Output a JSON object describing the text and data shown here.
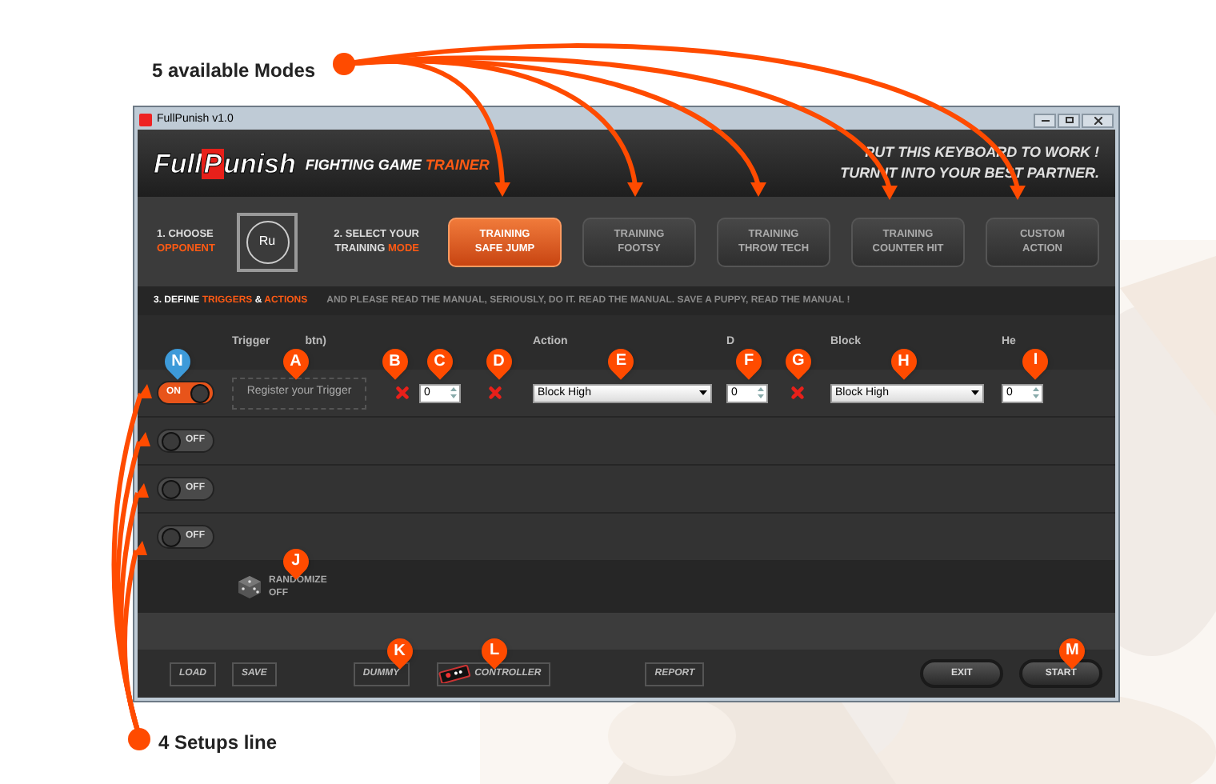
{
  "callouts": {
    "modes": "5 available Modes",
    "setups": "4 Setups line"
  },
  "window": {
    "title": "FullPunish v1.0"
  },
  "header": {
    "logo": [
      {
        "text": "Full",
        "accent": false
      },
      {
        "text": "P",
        "accent": true
      },
      {
        "text": "unish",
        "accent": false
      }
    ],
    "tagline": [
      {
        "text": "FIGHTING",
        "accent": false
      },
      {
        "text": " GAME ",
        "accent": false
      },
      {
        "text": "TRAINER",
        "accent": true
      }
    ],
    "slogan": [
      "PUT THIS KEYBOARD TO WORK !",
      "TURN IT INTO YOUR BEST PARTNER."
    ]
  },
  "steps": [
    {
      "lines": [
        [
          {
            "text": "1. CHOOSE",
            "accent": false
          }
        ],
        [
          {
            "text": "OPPONENT",
            "accent": true
          }
        ]
      ]
    },
    {
      "lines": [
        [
          {
            "text": "2. SELECT YOUR",
            "accent": false
          }
        ],
        [
          {
            "text": "TRAINING ",
            "accent": false
          },
          {
            "text": "MODE",
            "accent": true
          }
        ]
      ]
    }
  ],
  "opponent": "Ru",
  "modes": [
    {
      "lines": [
        "TRAINING",
        "SAFE JUMP"
      ],
      "selected": true
    },
    {
      "lines": [
        "TRAINING",
        "FOOTSY"
      ],
      "selected": false
    },
    {
      "lines": [
        "TRAINING",
        "THROW TECH"
      ],
      "selected": false
    },
    {
      "lines": [
        "TRAINING",
        "COUNTER HIT"
      ],
      "selected": false
    },
    {
      "lines": [
        "CUSTOM",
        "ACTION"
      ],
      "selected": false
    }
  ],
  "section": {
    "title": [
      {
        "text": "3. DEFINE ",
        "accent": false
      },
      {
        "text": "TRIGGERS",
        "accent": true
      },
      {
        "text": " & ",
        "accent": false
      },
      {
        "text": "ACTIONS",
        "accent": true
      }
    ],
    "note": "AND PLEASE READ THE MANUAL, SERIOUSLY, DO IT. READ THE MANUAL. SAVE A PUPPY, READ THE MANUAL !"
  },
  "columns": [
    "Trigger",
    "btn)",
    "Action",
    "D",
    "Block",
    "He"
  ],
  "setups": [
    {
      "on": true,
      "state_label": "ON",
      "trigger": "Register your Trigger",
      "value_c": "0",
      "action": "Block High",
      "value_f": "0",
      "block": "Block High",
      "value_i": "0"
    },
    {
      "on": false,
      "state_label": "OFF"
    },
    {
      "on": false,
      "state_label": "OFF"
    },
    {
      "on": false,
      "state_label": "OFF"
    }
  ],
  "randomize": {
    "label": "RANDOMIZE",
    "value": "OFF"
  },
  "footer": [
    {
      "label": "LOAD",
      "kind": "flat"
    },
    {
      "label": "SAVE",
      "kind": "flat"
    },
    {
      "label": "DUMMY",
      "kind": "flat"
    },
    {
      "label": "CONTROLLER",
      "kind": "controller"
    },
    {
      "label": "REPORT",
      "kind": "flat"
    },
    {
      "label": "EXIT",
      "kind": "pill"
    },
    {
      "label": "START",
      "kind": "pill"
    }
  ],
  "markers": [
    {
      "letter": "N",
      "color": "#3d9ad9"
    },
    {
      "letter": "A",
      "color": "#ff4b00"
    },
    {
      "letter": "B",
      "color": "#ff4b00"
    },
    {
      "letter": "C",
      "color": "#ff4b00"
    },
    {
      "letter": "D",
      "color": "#ff4b00"
    },
    {
      "letter": "E",
      "color": "#ff4b00"
    },
    {
      "letter": "F",
      "color": "#ff4b00"
    },
    {
      "letter": "G",
      "color": "#ff4b00"
    },
    {
      "letter": "H",
      "color": "#ff4b00"
    },
    {
      "letter": "I",
      "color": "#ff4b00"
    },
    {
      "letter": "J",
      "color": "#ff4b00"
    },
    {
      "letter": "K",
      "color": "#ff4b00"
    },
    {
      "letter": "L",
      "color": "#ff4b00"
    },
    {
      "letter": "M",
      "color": "#ff4b00"
    }
  ]
}
